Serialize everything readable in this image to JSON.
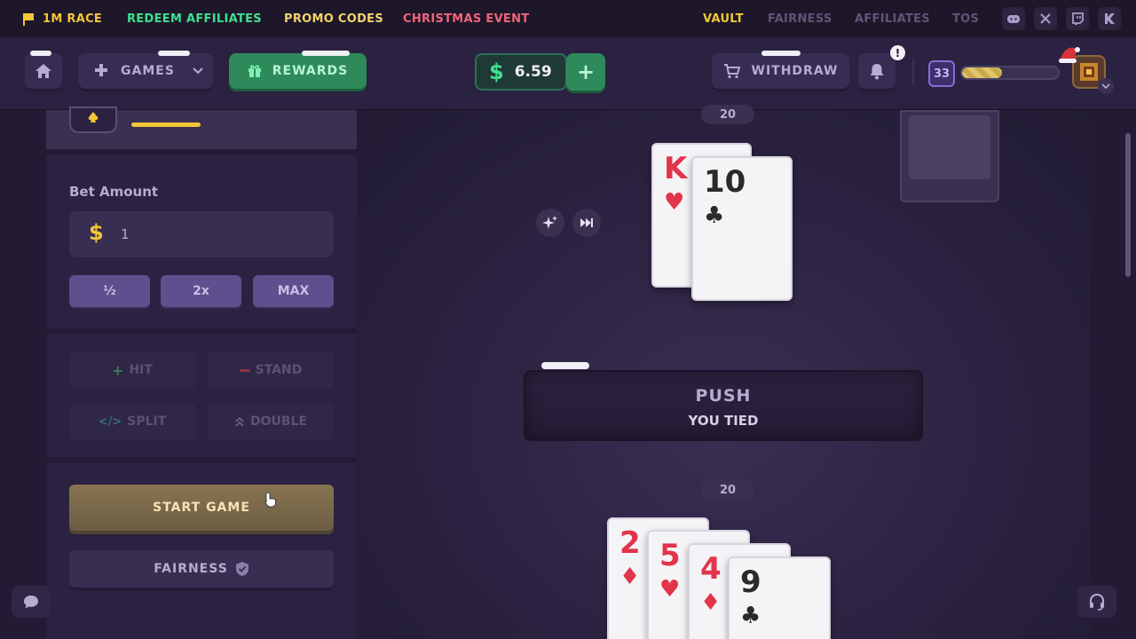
{
  "topbar": {
    "race": "1M RACE",
    "redeem": "REDEEM AFFILIATES",
    "promo": "PROMO CODES",
    "christmas": "CHRISTMAS EVENT",
    "vault": "VAULT",
    "fairness": "FAIRNESS",
    "affiliates": "AFFILIATES",
    "tos": "TOS",
    "colors": {
      "race": "#f3c737",
      "redeem": "#3ee08f",
      "promo": "#f3d36b",
      "christmas": "#f0637a"
    }
  },
  "header": {
    "games_label": "GAMES",
    "rewards_label": "REWARDS",
    "balance": "6.59",
    "withdraw_label": "WITHDRAW",
    "notification_badge": "!",
    "level": "33",
    "xp_progress": 0.42
  },
  "sidebar": {
    "bet_amount_label": "Bet Amount",
    "bet_value": "1",
    "half_label": "½",
    "double_label": "2x",
    "max_label": "MAX",
    "hit_label": "HIT",
    "stand_label": "STAND",
    "split_label": "SPLIT",
    "double_action_label": "DOUBLE",
    "start_label": "START GAME",
    "fairness_label": "FAIRNESS"
  },
  "game": {
    "dealer_score": "20",
    "player_score": "20",
    "result_title": "PUSH",
    "result_subtitle": "YOU TIED",
    "dealer_cards": [
      {
        "rank": "K",
        "suit": "♥",
        "color": "red"
      },
      {
        "rank": "10",
        "suit": "♣",
        "color": "black"
      }
    ],
    "player_cards": [
      {
        "rank": "2",
        "suit": "♦",
        "color": "red"
      },
      {
        "rank": "5",
        "suit": "♥",
        "color": "red"
      },
      {
        "rank": "4",
        "suit": "♦",
        "color": "red"
      },
      {
        "rank": "9",
        "suit": "♣",
        "color": "black"
      }
    ]
  },
  "icons": {
    "currency": "$",
    "add": "+",
    "discord": "discord-icon",
    "x": "x-icon",
    "twitch": "twitch-icon",
    "kick": "kick-icon"
  }
}
